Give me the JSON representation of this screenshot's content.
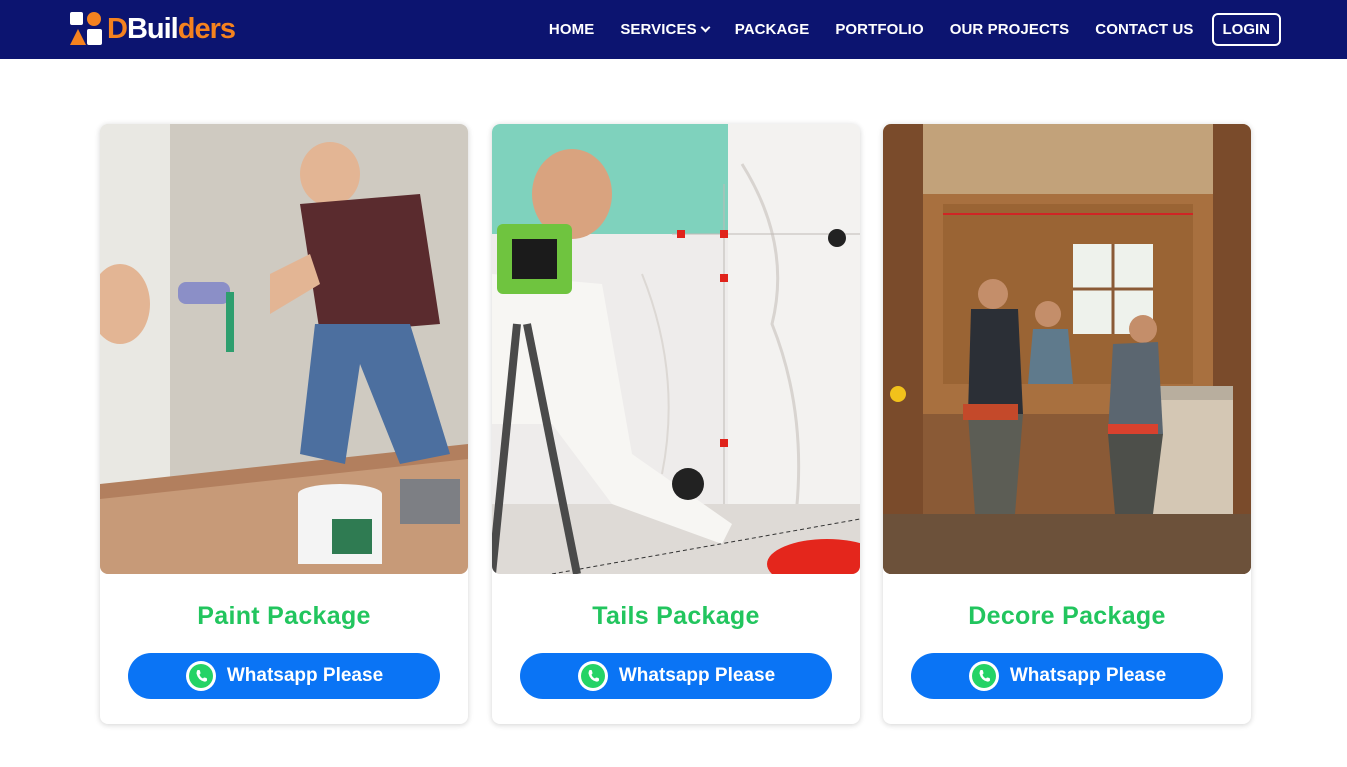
{
  "brand": {
    "d": "D",
    "build": "Buil",
    "ders_d": "d",
    "ers": "ers"
  },
  "nav": {
    "home": "HOME",
    "services": "SERVICES",
    "package": "PACKAGE",
    "portfolio": "PORTFOLIO",
    "projects": "OUR PROJECTS",
    "contact": "CONTACT US",
    "login": "LOGIN"
  },
  "cards": [
    {
      "title": "Paint Package",
      "button": "Whatsapp Please"
    },
    {
      "title": "Tails Package",
      "button": "Whatsapp Please"
    },
    {
      "title": "Decore Package",
      "button": "Whatsapp Please"
    }
  ],
  "colors": {
    "nav_bg": "#0c1470",
    "accent": "#f5821f",
    "title_green": "#22c55e",
    "button_blue": "#0a74f5",
    "whatsapp_green": "#25d366"
  },
  "icons": {
    "services_dropdown": "chevron-down-icon",
    "whatsapp": "whatsapp-icon"
  }
}
